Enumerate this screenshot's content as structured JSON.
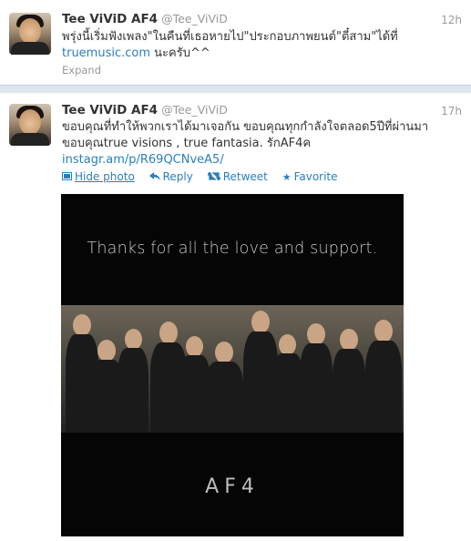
{
  "tweets": [
    {
      "name": "Tee ViViD AF4",
      "handle": "@Tee_ViViD",
      "time": "12h",
      "text_line1": "พรุ่งนี้เริ่มฟังเพลง\"ในคืนที่เธอหายไป\"ประกอบภาพยนต์\"ตี๋สาม\"ได้ที่",
      "link": "truemusic.com",
      "text_after_link": " นะครับ^^",
      "expand": "Expand"
    },
    {
      "name": "Tee ViViD AF4",
      "handle": "@Tee_ViViD",
      "time": "17h",
      "text_line1": "ขอบคุณที่ทำให้พวกเราได้มาเจอกัน ขอบคุณทุกกำลังใจตลอด5ปีที่ผ่านมา",
      "text_line2": "ขอบคุณtrue visions , true fantasia. รักAF4ค",
      "link": "instagr.am/p/R69QCNveA5/",
      "actions": {
        "hide_photo": "Hide photo",
        "reply": "Reply",
        "retweet": "Retweet",
        "favorite": "Favorite"
      },
      "photo": {
        "caption_top": "Thanks for all the love and support.",
        "caption_bottom": "AF4"
      }
    }
  ],
  "colors": {
    "link": "#2a7fbf",
    "divider": "#dde6ee",
    "name": "#333333",
    "muted": "#999999"
  },
  "icons": [
    "photo-icon",
    "reply-icon",
    "retweet-icon",
    "favorite-star-icon"
  ]
}
